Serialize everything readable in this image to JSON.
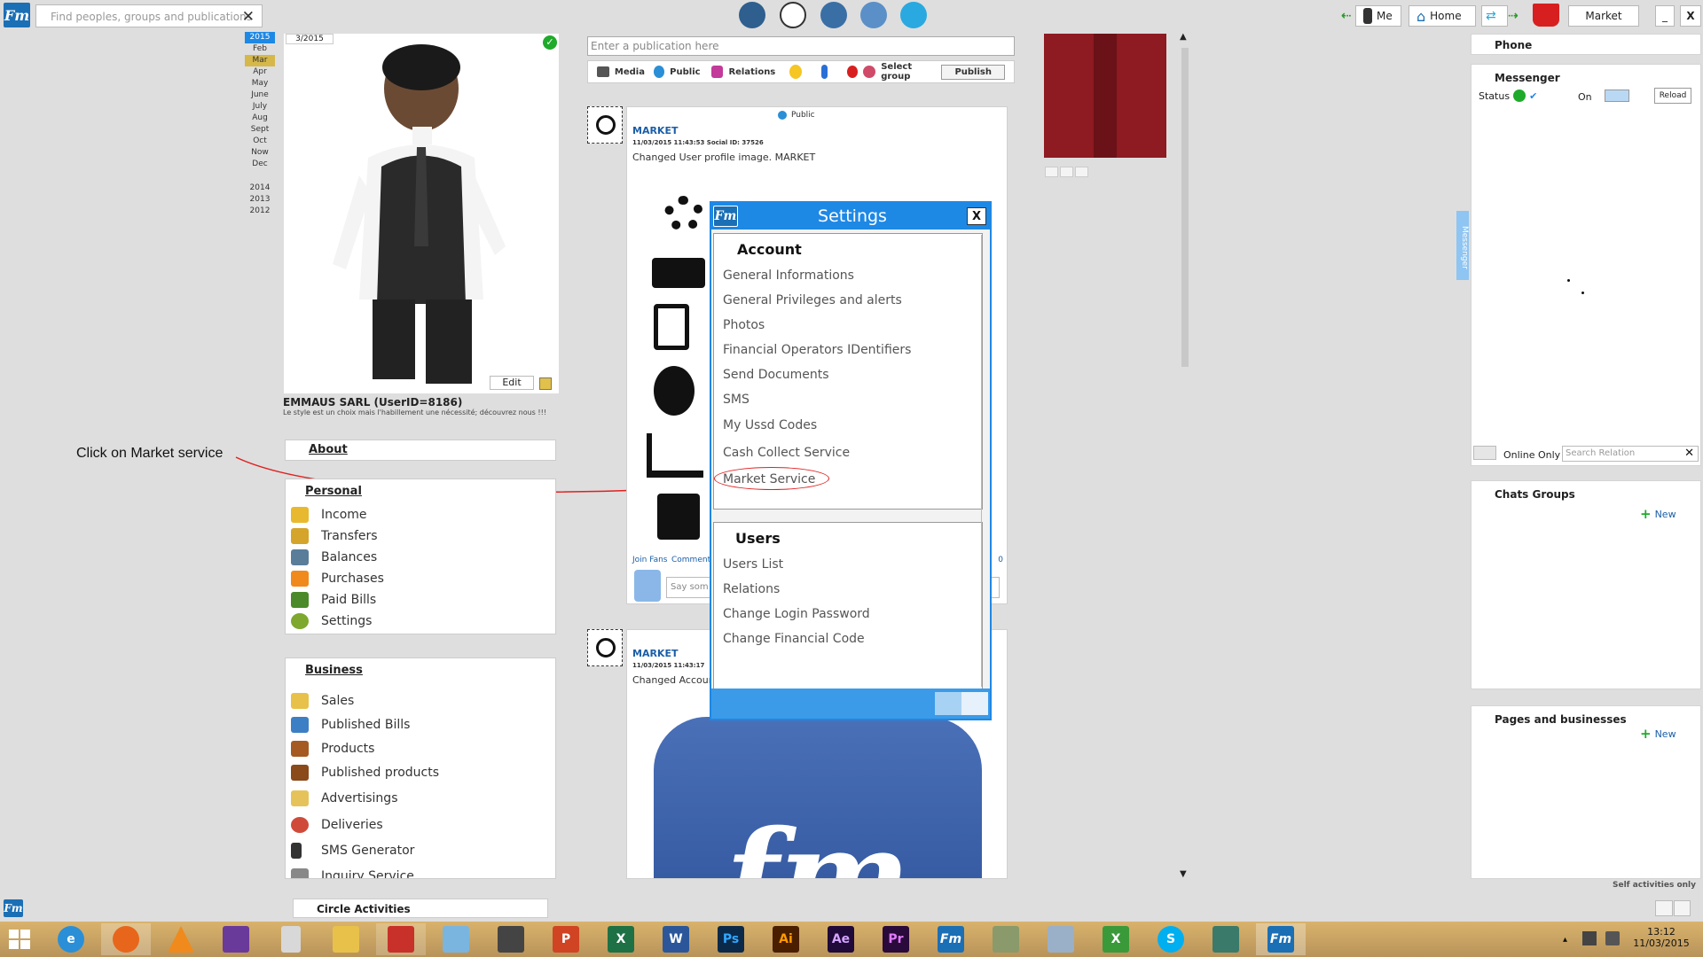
{
  "topbar": {
    "search_placeholder": "Find peoples, groups and publications",
    "search_clear": "✕",
    "me_label": "Me",
    "home_label": "Home",
    "market_label": "Market",
    "minimize_label": "_",
    "close_label": "X"
  },
  "year_nav": {
    "selected_year": "2015",
    "months": [
      "Feb",
      "Mar",
      "Apr",
      "May",
      "June",
      "July",
      "Aug",
      "Sept",
      "Oct",
      "Now",
      "Dec"
    ],
    "selected_month": "Mar",
    "years": [
      "2014",
      "2013",
      "2012"
    ]
  },
  "profile": {
    "date_badge": "3/2015",
    "edit_label": "Edit",
    "name": "EMMAUS SARL (UserID=8186)",
    "tagline": "Le style est un choix mais l'habillement une nécessité; découvrez nous !!!"
  },
  "annotation": {
    "text": "Click on Market service"
  },
  "about": {
    "title": "About"
  },
  "personal": {
    "title": "Personal",
    "items": [
      {
        "label": "Income"
      },
      {
        "label": "Transfers"
      },
      {
        "label": "Balances"
      },
      {
        "label": "Purchases"
      },
      {
        "label": "Paid Bills"
      },
      {
        "label": "Settings"
      }
    ]
  },
  "business": {
    "title": "Business",
    "items": [
      {
        "label": "Sales"
      },
      {
        "label": "Published Bills"
      },
      {
        "label": "Products"
      },
      {
        "label": "Published products"
      },
      {
        "label": "Advertisings"
      },
      {
        "label": "Deliveries"
      },
      {
        "label": "SMS Generator"
      },
      {
        "label": "Inquiry Service"
      }
    ]
  },
  "circle_activities": {
    "title": "Circle Activities"
  },
  "composer": {
    "placeholder": "Enter a publication here",
    "media_label": "Media",
    "public_label": "Public",
    "relations_label": "Relations",
    "select_group_label": "Select group",
    "publish_label": "Publish"
  },
  "posts": [
    {
      "visibility": "Public",
      "author": "MARKET",
      "meta": "11/03/2015 11:43:53   Social ID: 37526",
      "text": "Changed User profile image. MARKET",
      "join_fans": "Join Fans",
      "comment": "Comment",
      "count": "0",
      "reply_placeholder": "Say som"
    },
    {
      "author": "MARKET",
      "meta": "11/03/2015 11:43:17",
      "text": "Changed Accoun"
    }
  ],
  "settings_modal": {
    "title": "Settings",
    "close_label": "X",
    "account_title": "Account",
    "account_items": [
      {
        "label": "General Informations"
      },
      {
        "label": "General Privileges and alerts"
      },
      {
        "label": "Photos"
      },
      {
        "label": "Financial Operators IDentifiers"
      },
      {
        "label": "Send Documents"
      },
      {
        "label": "SMS"
      },
      {
        "label": "My Ussd Codes"
      },
      {
        "label": "Cash Collect Service"
      },
      {
        "label": "Market Service"
      }
    ],
    "users_title": "Users",
    "users_items": [
      {
        "label": "Users List"
      },
      {
        "label": "Relations"
      },
      {
        "label": "Change Login Password"
      },
      {
        "label": "Change Financial Code"
      }
    ]
  },
  "right_panel": {
    "phone_title": "Phone",
    "messenger_title": "Messenger",
    "status_label": "Status",
    "on_label": "On",
    "reload_label": "Reload",
    "side_tab": "Messenger",
    "online_only_label": "Online Only",
    "search_relation_placeholder": "Search Relation",
    "chats_groups_title": "Chats Groups",
    "new_label": "New",
    "pages_title": "Pages and businesses",
    "pages_new_label": "New",
    "self_activities": "Self activities only"
  },
  "taskbar": {
    "time": "13:12",
    "date": "11/03/2015"
  },
  "colors": {
    "accent_blue": "#1e88e5",
    "annotation_red": "#e02020",
    "link_blue": "#1b5ea8",
    "new_green": "#1faa2b"
  }
}
